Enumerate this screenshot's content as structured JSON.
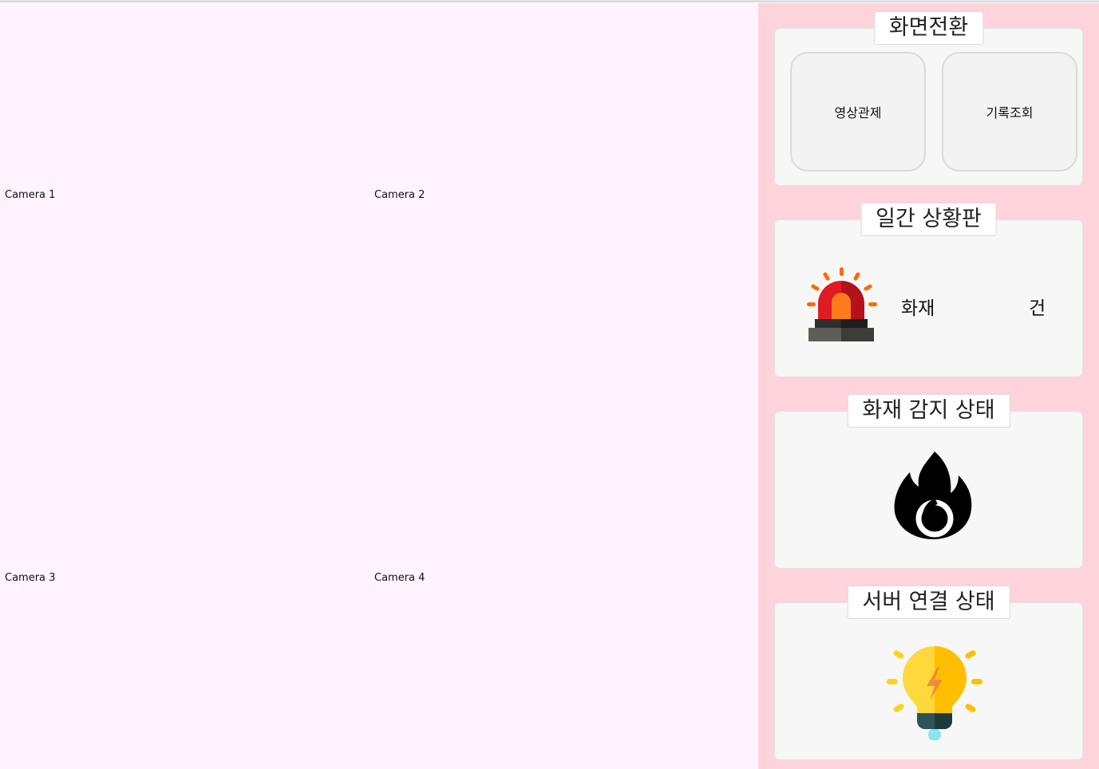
{
  "cameras": [
    {
      "label": "Camera 1"
    },
    {
      "label": "Camera 2"
    },
    {
      "label": "Camera 3"
    },
    {
      "label": "Camera 4"
    }
  ],
  "screen_switch": {
    "title": "화면전환",
    "buttons": [
      {
        "label": "영상관제"
      },
      {
        "label": "기록조회"
      }
    ]
  },
  "daily_status": {
    "title": "일간 상황판",
    "icon": "siren-icon",
    "category": "화재",
    "count": "",
    "unit": "건"
  },
  "fire_detection": {
    "title": "화재 감지 상태",
    "icon": "flame-icon"
  },
  "server_connection": {
    "title": "서버 연결 상태",
    "icon": "lightbulb-icon"
  },
  "colors": {
    "video_bg": "#fff3ff",
    "sidebar_bg": "#ffd3db",
    "panel_bg": "#f7f7f7"
  }
}
